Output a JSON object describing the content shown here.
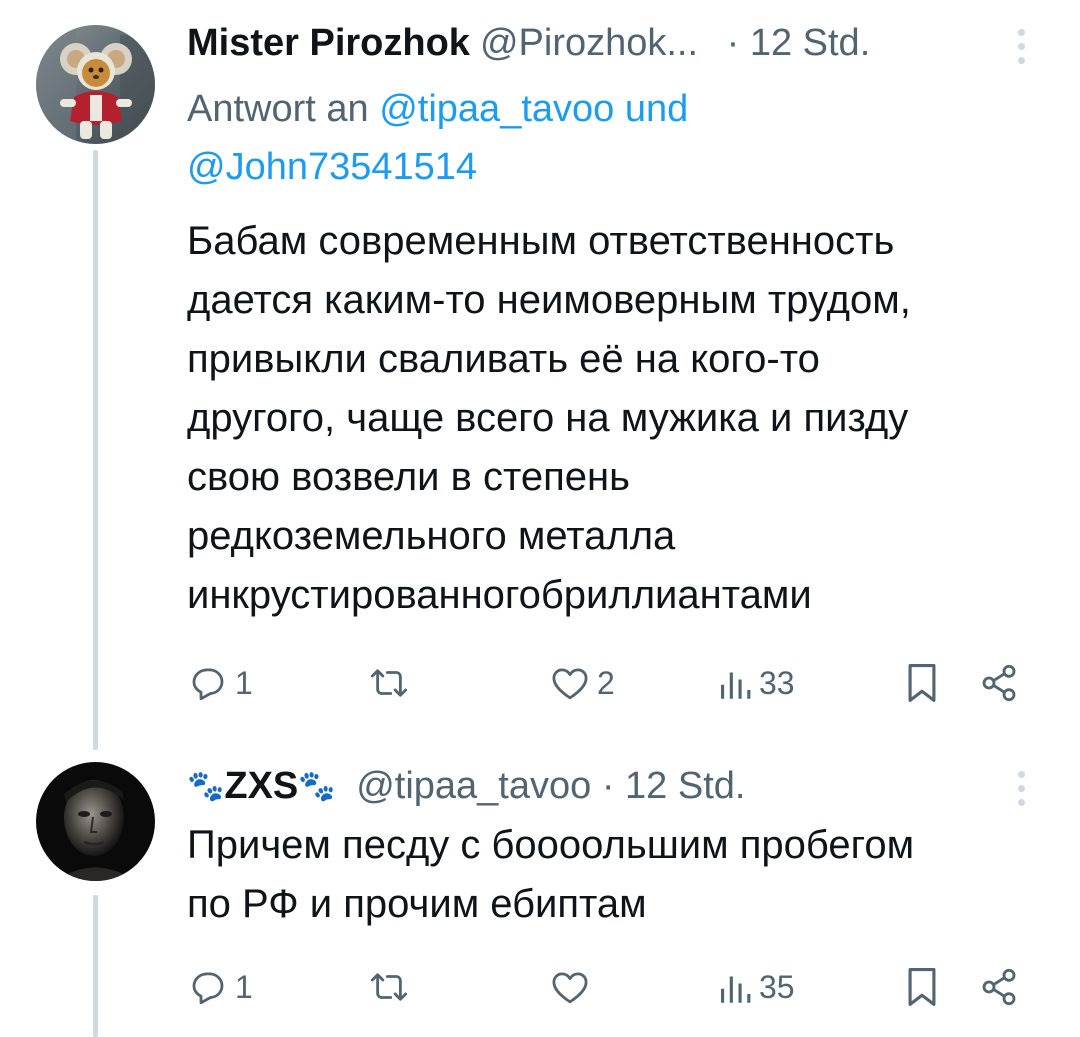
{
  "tweets": [
    {
      "display_name": "Mister Pirozhok",
      "handle": "@Pirozhok...",
      "separator": "·",
      "time": "12 Std.",
      "reply_prefix": "Antwort an",
      "reply_mention_1": "@tipaa_tavoo",
      "reply_conjunction": "und",
      "reply_mention_2": "@John73541514",
      "text": "Бабам современным ответственность\nдается каким-то неимоверным трудом,\nпривыкли сваливать её на кого-то\nдругого, чаще всего на мужика и пизду\nсвою возвели в степень\nредкоземельного металла\nинкрустированногобриллиантами",
      "replies": "1",
      "retweets": "",
      "likes": "2",
      "views": "33",
      "avatar_icon": "cheburashka-avatar-icon"
    },
    {
      "display_name_prefix_emoji": "🐾",
      "display_name": "ZXS",
      "display_name_suffix_emoji": "🐾",
      "handle": "@tipaa_tavoo",
      "separator": "·",
      "time": "12 Std.",
      "text": "Причем песду с бoooольшим пробегом\nпо РФ и прочим ебиптам",
      "replies": "1",
      "retweets": "",
      "likes": "",
      "views": "35",
      "avatar_icon": "dark-portrait-avatar-icon"
    }
  ],
  "colors": {
    "text_primary": "#0f1419",
    "text_secondary": "#536471",
    "link": "#1d9bf0",
    "thread_line": "#cfd9de"
  },
  "icons": {
    "reply": "reply-icon",
    "retweet": "retweet-icon",
    "like": "heart-icon",
    "views": "views-icon",
    "bookmark": "bookmark-icon",
    "share": "share-icon",
    "more": "more-dots-icon"
  }
}
